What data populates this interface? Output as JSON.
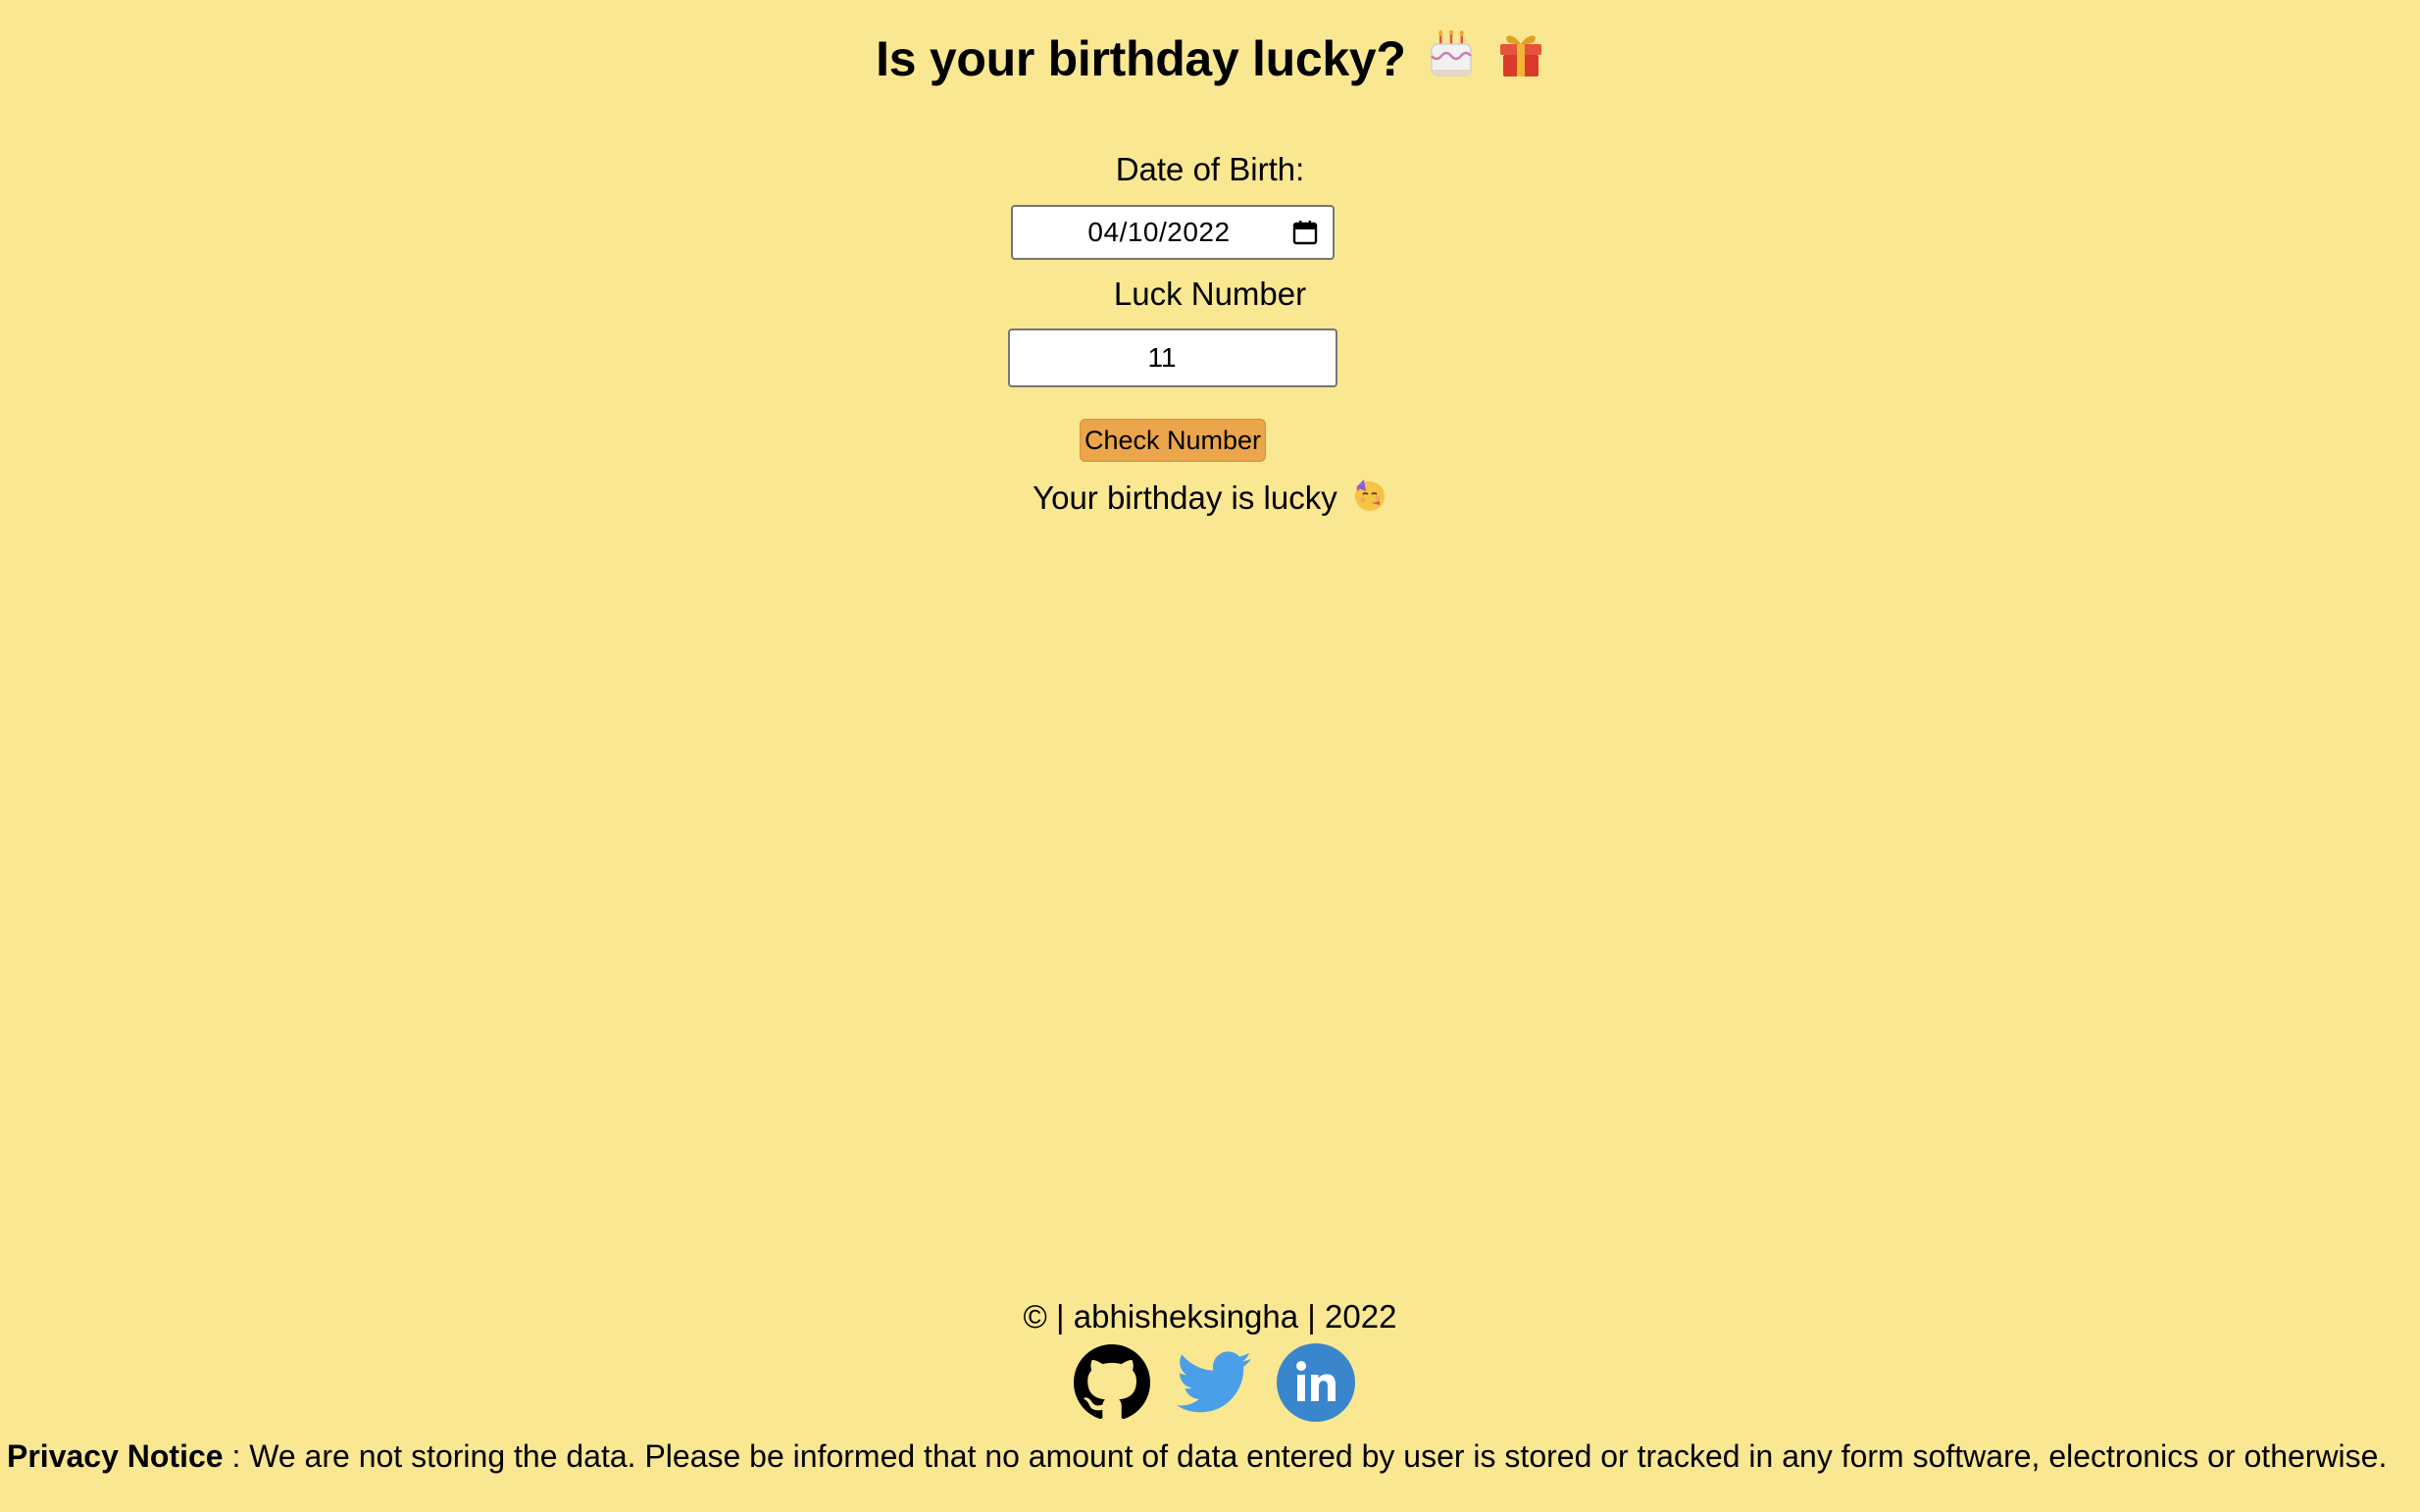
{
  "header": {
    "title": "Is your birthday lucky?",
    "title_emojis": [
      "cake-icon",
      "gift-icon"
    ]
  },
  "form": {
    "dob_label": "Date of Birth:",
    "dob_value": "04/10/2022",
    "luck_label": "Luck Number",
    "luck_value": "11",
    "check_button": "Check Number"
  },
  "result": {
    "text": "Your birthday is lucky",
    "emoji": "partying-face-icon"
  },
  "footer": {
    "credit": "© | abhisheksingha | 2022",
    "socials": [
      "github-icon",
      "twitter-icon",
      "linkedin-icon"
    ],
    "privacy_title": "Privacy Notice",
    "privacy_text": " : We are not storing the data. Please be informed that no amount of data entered by user is stored or tracked in any form software, electronics or otherwise."
  },
  "colors": {
    "background": "#f9e792",
    "button": "#eba54a",
    "twitter": "#4a9fe8",
    "linkedin": "#3a86cc"
  }
}
